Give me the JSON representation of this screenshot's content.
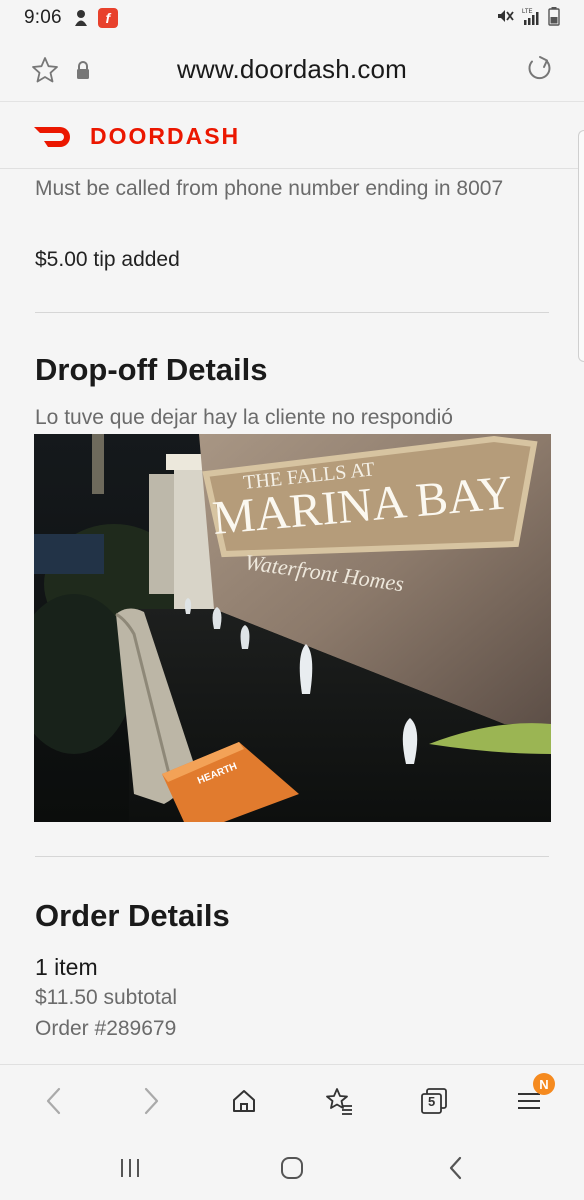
{
  "status_bar": {
    "time": "9:06",
    "app_badge": "f",
    "network": "LTE"
  },
  "browser": {
    "url": "www.doordash.com",
    "tab_count": "5",
    "menu_badge": "N"
  },
  "site": {
    "brand": "DOORDASH",
    "brand_color": "#eb1700"
  },
  "delivery": {
    "dasher_note": "Must be called from phone number ending in 8007",
    "tip": "$5.00 tip added"
  },
  "dropoff": {
    "title": "Drop-off Details",
    "note": "Lo tuve que dejar hay la cliente no respondió",
    "photo": {
      "sign_line1": "THE FALLS AT",
      "sign_line2": "MARINA BAY",
      "sign_line3": "Waterfront Homes"
    }
  },
  "order": {
    "title": "Order Details",
    "items": "1 item",
    "subtotal": "$11.50 subtotal",
    "number": "Order #289679"
  },
  "icons": {
    "bookmark": "star-icon",
    "secure": "lock-icon",
    "reload": "reload-icon",
    "back": "chevron-left-icon",
    "forward": "chevron-right-icon",
    "home": "home-icon",
    "bookmarks": "star-list-icon",
    "tabs": "tabs-icon",
    "menu": "menu-icon"
  }
}
